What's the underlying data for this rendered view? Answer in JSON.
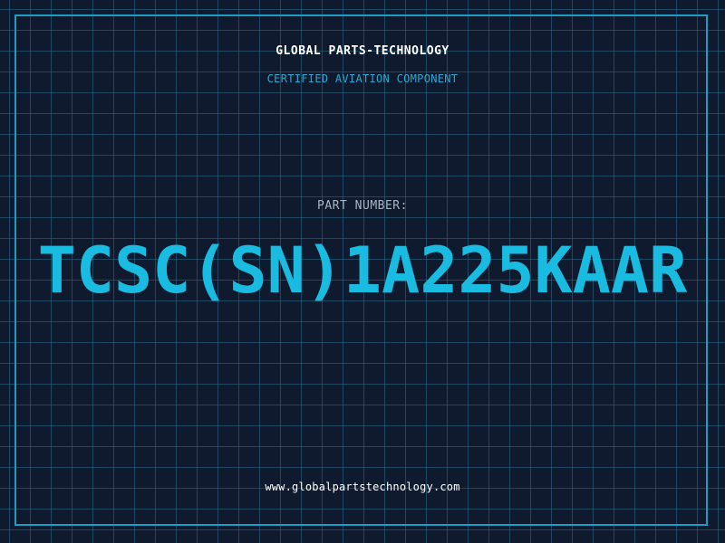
{
  "colors": {
    "background": "#0f1a2e",
    "grid": "#266e8a",
    "frame": "#1e9cc4",
    "accent": "#19bce0",
    "subtitle": "#27a9d4",
    "label": "#a9b4c2",
    "text": "#ffffff"
  },
  "header": {
    "company": "GLOBAL PARTS-TECHNOLOGY",
    "tagline": "CERTIFIED AVIATION COMPONENT"
  },
  "main": {
    "label": "PART NUMBER:",
    "part_number": "TCSC(SN)1A225KAAR"
  },
  "footer": {
    "website": "www.globalpartstechnology.com"
  }
}
